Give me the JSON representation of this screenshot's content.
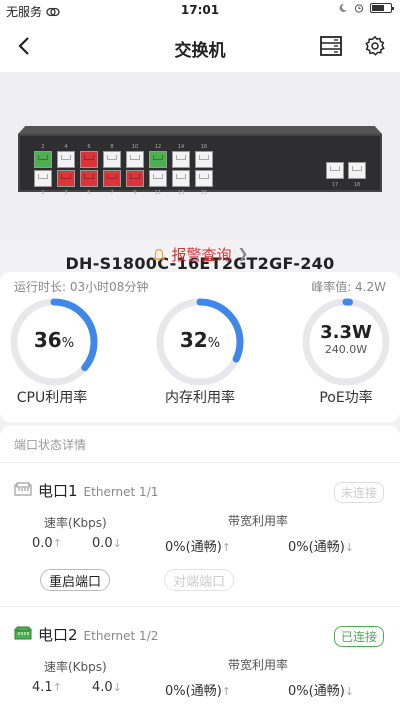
{
  "status_bar": {
    "carrier": "无服务",
    "time": "17:01"
  },
  "nav": {
    "title": "交换机"
  },
  "device": {
    "model": "DH-S1800C-16ET2GT2GF-240",
    "top_ports": [
      {
        "num": "2",
        "state": "green"
      },
      {
        "num": "4",
        "state": "empty"
      },
      {
        "num": "6",
        "state": "red"
      },
      {
        "num": "8",
        "state": "empty"
      },
      {
        "num": "10",
        "state": "empty"
      },
      {
        "num": "12",
        "state": "green"
      },
      {
        "num": "14",
        "state": "empty"
      },
      {
        "num": "16",
        "state": "empty"
      }
    ],
    "bottom_ports": [
      {
        "num": "1",
        "state": "empty"
      },
      {
        "num": "3",
        "state": "red"
      },
      {
        "num": "5",
        "state": "red"
      },
      {
        "num": "7",
        "state": "red"
      },
      {
        "num": "9",
        "state": "red"
      },
      {
        "num": "11",
        "state": "empty"
      },
      {
        "num": "13",
        "state": "empty"
      },
      {
        "num": "15",
        "state": "empty"
      }
    ],
    "uplink_ports": [
      {
        "num": "17"
      },
      {
        "num": "18"
      }
    ]
  },
  "alarm": {
    "label": "报警查询"
  },
  "stats": {
    "uptime": "运行时长: 03小时08分钟",
    "peak": "峰率值: 4.2W",
    "cpu": {
      "value": "36",
      "unit": "%",
      "label": "CPU利用率",
      "fraction": 0.36
    },
    "memory": {
      "value": "32",
      "unit": "%",
      "label": "内存利用率",
      "fraction": 0.32
    },
    "poe": {
      "value": "3.3W",
      "sub": "240.0W",
      "label": "PoE功率",
      "fraction": 0.014
    }
  },
  "ports_section": {
    "title": "端口状态详情",
    "speed_label": "速率(Kbps)",
    "bw_label": "带宽利用率",
    "ports": [
      {
        "name": "电口1",
        "sub": "Ethernet 1/1",
        "status": "未连接",
        "speed_up": "0.0",
        "speed_down": "0.0",
        "bw_up": "0%(通畅)",
        "bw_down": "0%(通畅)",
        "restart": "重启端口",
        "loopback": "对端端口"
      },
      {
        "name": "电口2",
        "sub": "Ethernet 1/2",
        "status": "已连接",
        "speed_up": "4.1",
        "speed_down": "4.0",
        "bw_up": "0%(通畅)",
        "bw_down": "0%(通畅)"
      }
    ]
  },
  "colors": {
    "accent": "#3f87e8",
    "track": "#e8e8ea",
    "alarm": "#d9353b",
    "online": "#4caf50"
  }
}
